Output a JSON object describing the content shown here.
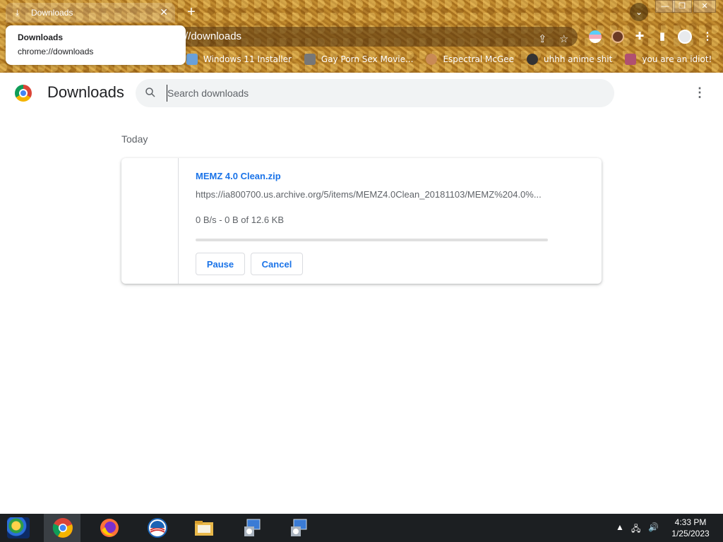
{
  "browser": {
    "tab": {
      "title": "Downloads"
    },
    "omnibox": {
      "url": "//downloads"
    },
    "bookmarks": [
      {
        "label": "Windows 11 Installer",
        "color": "#6aa0d8"
      },
      {
        "label": "Gay Porn Sex Movie...",
        "color": "#777777"
      },
      {
        "label": "Espectral McGee",
        "color": "#c98a55"
      },
      {
        "label": "uhhh anime shit",
        "color": "#333333"
      },
      {
        "label": "you are an idiot!",
        "color": "#b05070"
      }
    ],
    "hover_card": {
      "title": "Downloads",
      "url": "chrome://downloads"
    }
  },
  "page": {
    "title": "Downloads",
    "search": {
      "placeholder": "Search downloads",
      "value": ""
    },
    "date_group": "Today",
    "download": {
      "file_name": "MEMZ 4.0 Clean.zip",
      "url": "https://ia800700.us.archive.org/5/items/MEMZ4.0Clean_20181103/MEMZ%204.0%...",
      "status": "0 B/s - 0 B of 12.6 KB",
      "progress": 0,
      "pause_label": "Pause",
      "cancel_label": "Cancel"
    }
  },
  "taskbar": {
    "apps": [
      "chrome",
      "firefox",
      "obama",
      "file-explorer",
      "installer",
      "installer"
    ],
    "clock_time": "4:33 PM",
    "clock_date": "1/25/2023"
  },
  "colors": {
    "accent": "#1a73e8",
    "theme": "#b47c28"
  }
}
